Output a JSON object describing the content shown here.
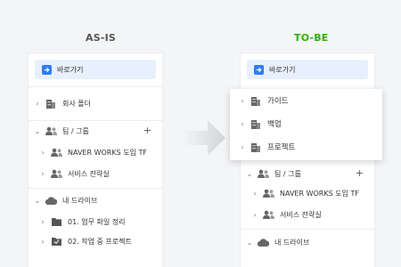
{
  "headings": {
    "as_is": "AS-IS",
    "to_be": "TO-BE"
  },
  "colors": {
    "to_be_heading": "#2db400",
    "accent": "#2f7df6",
    "goto_bg": "#e7f0fc"
  },
  "as_is": {
    "goto_label": "바로가기",
    "company_folder": "회사 폴더",
    "team_group": "팀 / 그룹",
    "team_items": [
      "NAVER WORKS 도입 TF",
      "서비스 전략실"
    ],
    "my_drive": "내 드라이브",
    "drive_items": [
      "01. 업무 파일 정리",
      "02. 작업 중 프로젝트"
    ]
  },
  "to_be": {
    "goto_label": "바로가기",
    "popup_items": [
      "가이드",
      "백업",
      "프로젝트"
    ],
    "team_group": "팀 / 그룹",
    "team_items": [
      "NAVER WORKS 도입 TF",
      "서비스 전략실"
    ],
    "my_drive": "내 드라이브"
  },
  "icons": [
    "arrow-right-icon",
    "building-icon",
    "people-icon",
    "cloud-icon",
    "folder-icon",
    "chevron-right-icon",
    "chevron-down-icon",
    "plus-icon"
  ]
}
